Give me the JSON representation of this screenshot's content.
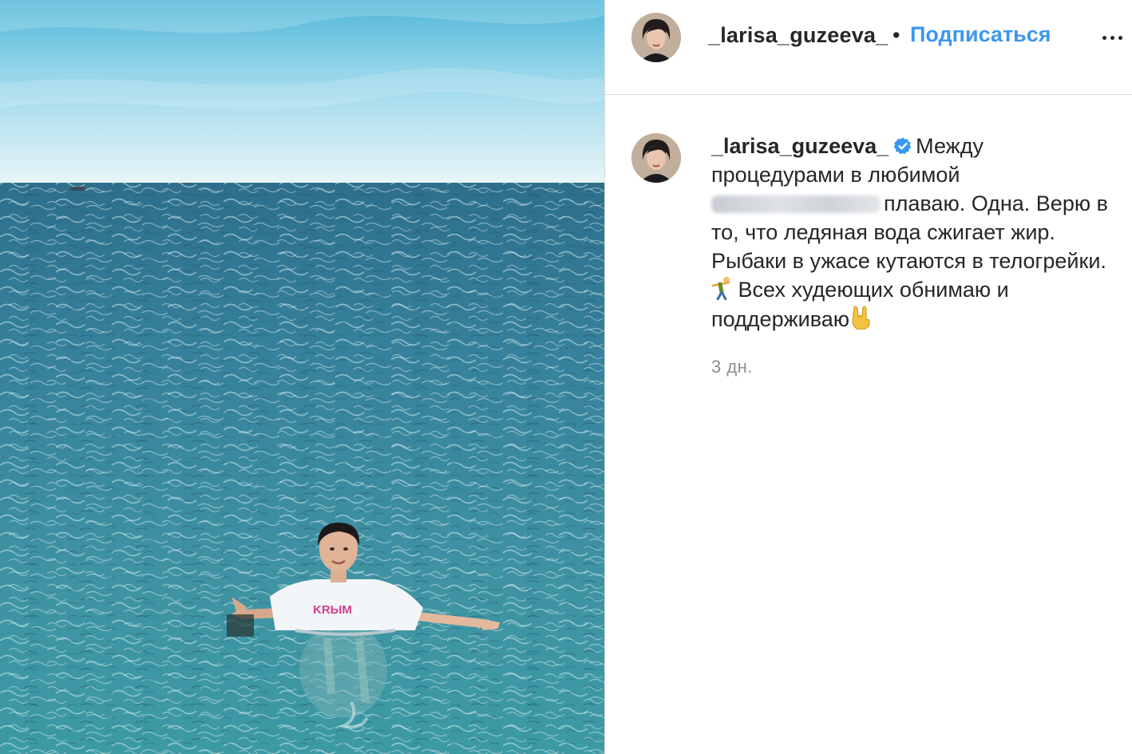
{
  "post": {
    "header": {
      "username": "_larisa_guzeeva_",
      "separator": "•",
      "follow_label": "Подписаться",
      "more_icon": "more-horizontal-icon"
    },
    "caption": {
      "username": "_larisa_guzeeva_",
      "verified_icon": "verified-badge-icon",
      "text_part1": "Между процедурами в любимой",
      "text_part2": "плаваю. Одна. Верю в то, что ледяная вода сжигает жир. Рыбаки в ужасе кутаются в телогрейки.",
      "emoji1": "cartwheel-emoji",
      "text_part3": "Всех худеющих обнимаю и поддерживаю",
      "emoji2": "horns-hand-emoji"
    },
    "timestamp": "3 дн.",
    "photo": {
      "shirt_text": "KRЫM"
    },
    "colors": {
      "accent": "#3b97f0",
      "text": "#262626",
      "muted": "#8e8e8e",
      "divider": "#dbdbdb"
    }
  }
}
